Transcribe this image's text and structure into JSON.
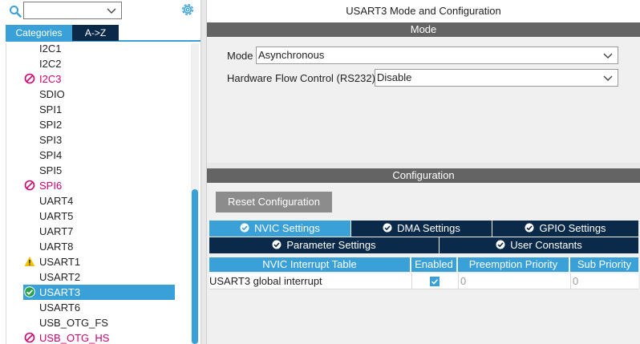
{
  "left": {
    "search": {
      "value": "",
      "placeholder": ""
    },
    "tabs": {
      "categories": "Categories",
      "az": "A->Z"
    },
    "items": [
      {
        "label": "I2C1",
        "status": "none"
      },
      {
        "label": "I2C2",
        "status": "none"
      },
      {
        "label": "I2C3",
        "status": "error"
      },
      {
        "label": "SDIO",
        "status": "none"
      },
      {
        "label": "SPI1",
        "status": "none"
      },
      {
        "label": "SPI2",
        "status": "none"
      },
      {
        "label": "SPI3",
        "status": "none"
      },
      {
        "label": "SPI4",
        "status": "none"
      },
      {
        "label": "SPI5",
        "status": "none"
      },
      {
        "label": "SPI6",
        "status": "error"
      },
      {
        "label": "UART4",
        "status": "none"
      },
      {
        "label": "UART5",
        "status": "none"
      },
      {
        "label": "UART7",
        "status": "none"
      },
      {
        "label": "UART8",
        "status": "none"
      },
      {
        "label": "USART1",
        "status": "warning"
      },
      {
        "label": "USART2",
        "status": "none"
      },
      {
        "label": "USART3",
        "status": "ok-selected"
      },
      {
        "label": "USART6",
        "status": "none"
      },
      {
        "label": "USB_OTG_FS",
        "status": "none"
      },
      {
        "label": "USB_OTG_HS",
        "status": "error"
      }
    ]
  },
  "right": {
    "title": "USART3 Mode and Configuration",
    "mode": {
      "header": "Mode",
      "mode_label": "Mode",
      "mode_value": "Asynchronous",
      "flow_label": "Hardware Flow Control (RS232)",
      "flow_value": "Disable"
    },
    "config": {
      "header": "Configuration",
      "reset_button": "Reset Configuration",
      "tabs": [
        {
          "label": "NVIC Settings",
          "active": true
        },
        {
          "label": "DMA Settings",
          "active": false
        },
        {
          "label": "GPIO Settings",
          "active": false
        },
        {
          "label": "Parameter Settings",
          "active": false
        },
        {
          "label": "User Constants",
          "active": false
        }
      ],
      "table": {
        "headers": [
          "NVIC Interrupt Table",
          "Enabled",
          "Preemption Priority",
          "Sub Priority"
        ],
        "rows": [
          {
            "name": "USART3 global interrupt",
            "enabled": true,
            "preemption": "0",
            "sub": "0"
          }
        ]
      }
    }
  },
  "colors": {
    "accent": "#3aa0d8",
    "dark_tab": "#0b2a4a",
    "section_bar": "#646464",
    "error": "#d10070",
    "warning": "#f2c200",
    "ok": "#2aa04a"
  },
  "icons": {
    "search": "search-icon",
    "settings": "gear-icon",
    "dropdown": "chevron-down-icon",
    "error": "no-entry-icon",
    "warning": "warning-triangle-icon",
    "ok": "check-circle-icon"
  }
}
